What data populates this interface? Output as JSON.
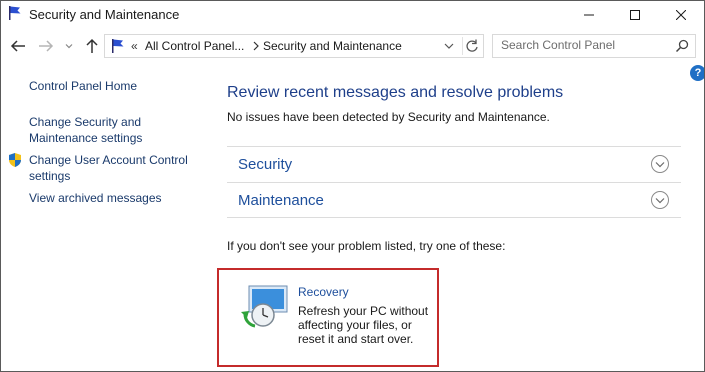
{
  "window": {
    "title": "Security and Maintenance"
  },
  "address_bar": {
    "overflow": "«",
    "crumbs": [
      "All Control Panel...",
      "Security and Maintenance"
    ]
  },
  "search": {
    "placeholder": "Search Control Panel"
  },
  "help": {
    "label": "?"
  },
  "sidebar": {
    "items": [
      {
        "label": "Control Panel Home"
      },
      {
        "label": "Change Security and Maintenance settings"
      },
      {
        "label": "Change User Account Control settings"
      },
      {
        "label": "View archived messages"
      }
    ]
  },
  "main": {
    "title": "Review recent messages and resolve problems",
    "status": "No issues have been detected by Security and Maintenance.",
    "sections": [
      {
        "label": "Security"
      },
      {
        "label": "Maintenance"
      }
    ],
    "hint": "If you don't see your problem listed, try one of these:",
    "recovery": {
      "title": "Recovery",
      "description": "Refresh your PC without affecting your files, or reset it and start over."
    }
  },
  "colors": {
    "link": "#1a3a6b",
    "heading": "#1e3f8a",
    "highlight_border": "#c42b2b"
  }
}
